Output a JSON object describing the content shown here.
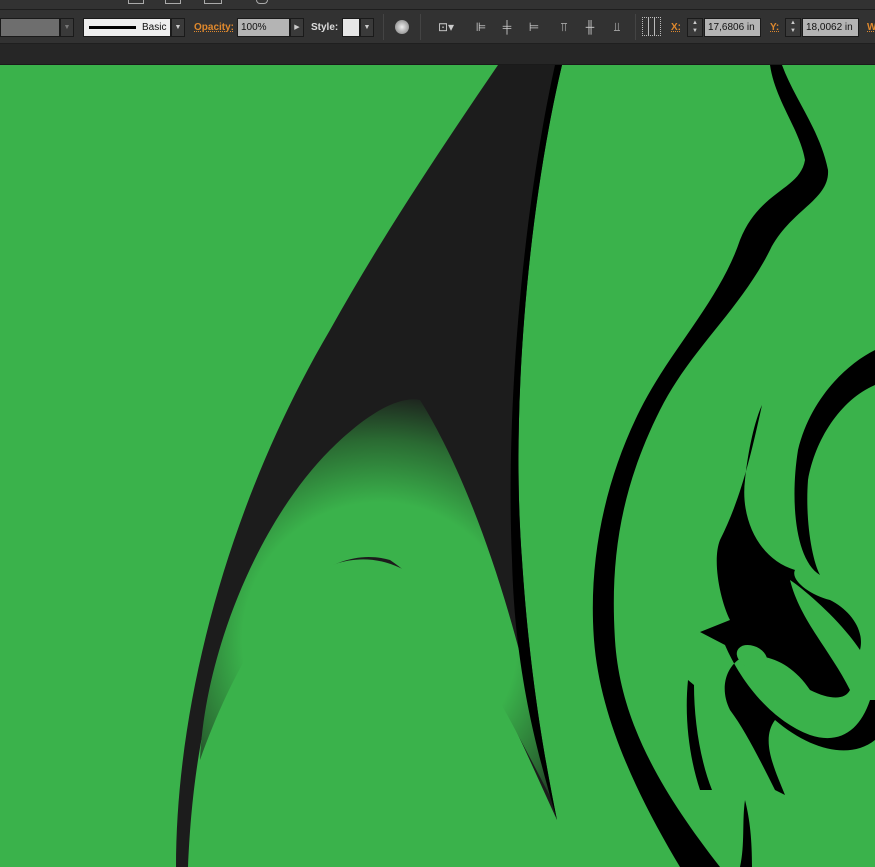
{
  "control_bar": {
    "stroke_profile": "Basic",
    "opacity_label": "Opacity:",
    "opacity_value": "100%",
    "style_label": "Style:",
    "x_label": "X:",
    "x_value": "17,6806 in",
    "y_label": "Y:",
    "y_value": "18,0062 in",
    "w_label": "W"
  },
  "colors": {
    "canvas": "#3ab24b",
    "accent_label": "#e0892d",
    "panel": "#323232"
  }
}
